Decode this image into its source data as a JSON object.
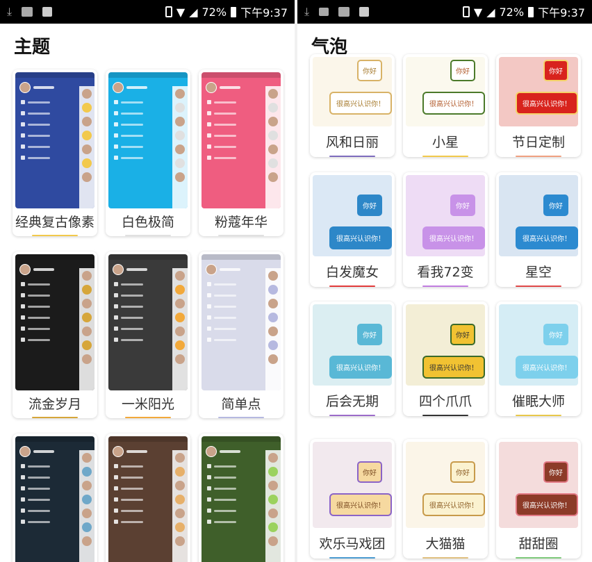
{
  "status": {
    "left_icons": [
      "download-icon",
      "pulse-icon",
      "square-icon"
    ],
    "right_icons": [
      "vibrate-icon",
      "wifi-icon",
      "signal-icon",
      "battery-icon"
    ],
    "battery": "72%",
    "time": "下午9:37"
  },
  "status_right_screen": {
    "left_icons": [
      "download-icon",
      "image-icon",
      "pulse-icon",
      "square-icon"
    ],
    "battery": "72%",
    "time": "下午9:37"
  },
  "themes": {
    "title": "主题",
    "items": [
      {
        "label": "经典复古像素",
        "bg": "#2f4aa0",
        "accent": "#f2c94c"
      },
      {
        "label": "白色极简",
        "bg": "#1ab0e6",
        "accent": "#e0e0e0"
      },
      {
        "label": "粉蔻年华",
        "bg": "#ef5d80",
        "accent": "#e0e0e0"
      },
      {
        "label": "流金岁月",
        "bg": "#1b1b1b",
        "accent": "#d6a63a"
      },
      {
        "label": "一米阳光",
        "bg": "#3a3a3a",
        "accent": "#f2a93b"
      },
      {
        "label": "简单点",
        "bg": "#d9dbea",
        "accent": "#b6b9e0"
      },
      {
        "label": "",
        "bg": "#1c2a36",
        "accent": "#6fa8c9"
      },
      {
        "label": "",
        "bg": "#5b4032",
        "accent": "#e7b06a"
      },
      {
        "label": "",
        "bg": "#3f5f2a",
        "accent": "#9bd25e"
      }
    ]
  },
  "bubbles": {
    "title": "气泡",
    "small_text": "你好",
    "big_text": "很高兴认识你！",
    "items": [
      {
        "label": "风和日丽",
        "bg": "#fbf6ea",
        "bubble": "#ffffff",
        "border": "#d8b266",
        "text": "#a67a2c",
        "line": "#7d6bbd"
      },
      {
        "label": "小星",
        "bg": "#fbf9ee",
        "bubble": "#ffffff",
        "border": "#4b7a2a",
        "text": "#b15a2a",
        "line": "#f2c94c"
      },
      {
        "label": "节日定制",
        "bg": "#f3c8c4",
        "bubble": "#d8231d",
        "border": "#f5d36a",
        "text": "#ffffff",
        "line": "#f0a080"
      },
      {
        "label": "白发魔女",
        "bg": "#dbe8f5",
        "bubble": "#2d87c8",
        "border": "#2d87c8",
        "text": "#ffffff",
        "line": "#e23a3a"
      },
      {
        "label": "看我72变",
        "bg": "#eedcf5",
        "bubble": "#c892e8",
        "border": "#c892e8",
        "text": "#ffffff",
        "line": "#c17de0"
      },
      {
        "label": "星空",
        "bg": "#d9e5f2",
        "bubble": "#2c8ad0",
        "border": "#2c8ad0",
        "text": "#ffffff",
        "line": "#e04848"
      },
      {
        "label": "后会无期",
        "bg": "#dbeef2",
        "bubble": "#59b8d6",
        "border": "#59b8d6",
        "text": "#ffffff",
        "line": "#9b6bc9"
      },
      {
        "label": "四个爪爪",
        "bg": "#f3eed6",
        "bubble": "#f1c232",
        "border": "#3a6a2a",
        "text": "#333333",
        "line": "#333333"
      },
      {
        "label": "催眠大师",
        "bg": "#d5edf5",
        "bubble": "#7dd0ec",
        "border": "#7dd0ec",
        "text": "#ffffff",
        "line": "#e8c84a"
      },
      {
        "label": "欢乐马戏团",
        "bg": "#f2e9ee",
        "bubble": "#f6d9a0",
        "border": "#8a63c7",
        "text": "#7a4a20",
        "line": "#4a9ad0"
      },
      {
        "label": "大猫猫",
        "bg": "#fbf5e8",
        "bubble": "#fbf2d0",
        "border": "#c79a4a",
        "text": "#8a5a20",
        "line": "#e0c080"
      },
      {
        "label": "甜甜圈",
        "bg": "#f4dcdc",
        "bubble": "#8c3b28",
        "border": "#e37a86",
        "text": "#ffffff",
        "line": "#7dc97a"
      }
    ]
  }
}
